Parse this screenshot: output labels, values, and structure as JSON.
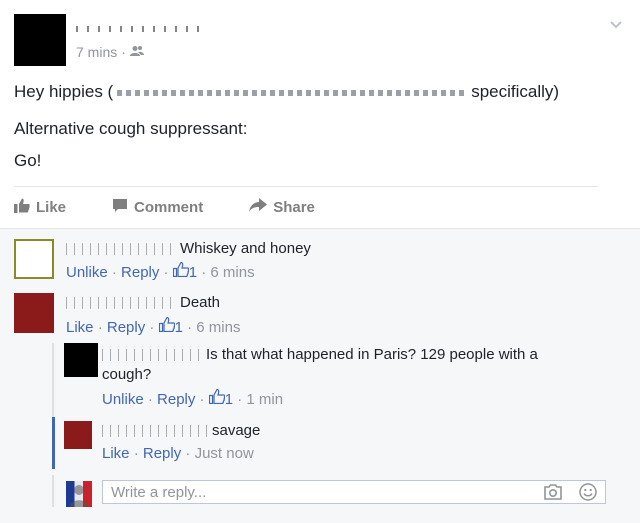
{
  "post": {
    "time": "7 mins",
    "separator": "·",
    "text_line1_start": "Hey hippies (",
    "text_line1_end": "specifically)",
    "text_line2": "Alternative cough suppressant:",
    "text_line3": "Go!"
  },
  "actions": {
    "like": "Like",
    "comment": "Comment",
    "share": "Share"
  },
  "comments": [
    {
      "text": "Whiskey and honey",
      "action_primary": "Unlike",
      "reply": "Reply",
      "likes": "1",
      "time": "6 mins",
      "avatar_color": "#8a8a2a"
    },
    {
      "text": "Death",
      "action_primary": "Like",
      "reply": "Reply",
      "likes": "1",
      "time": "6 mins",
      "avatar_color": "#8b1a1a"
    },
    {
      "text_line1": "Is that what happened in Paris? 129 people with a",
      "text_line2": "cough?",
      "action_primary": "Unlike",
      "reply": "Reply",
      "likes": "1",
      "time": "1 min",
      "avatar_color": "#000000"
    },
    {
      "text": "savage",
      "action_primary": "Like",
      "reply": "Reply",
      "time": "Just now",
      "avatar_color": "#8b1a1a"
    }
  ],
  "reply_box": {
    "placeholder": "Write a reply..."
  },
  "icons": {
    "audience": "friends-icon",
    "menu": "chevron-down-icon",
    "like": "thumbs-up-icon",
    "comment": "comment-icon",
    "share": "share-icon",
    "camera": "camera-icon",
    "emoji": "smiley-icon"
  },
  "colors": {
    "link": "#4267b2",
    "muted": "#90949c",
    "action_gray": "#7f7f7f"
  }
}
